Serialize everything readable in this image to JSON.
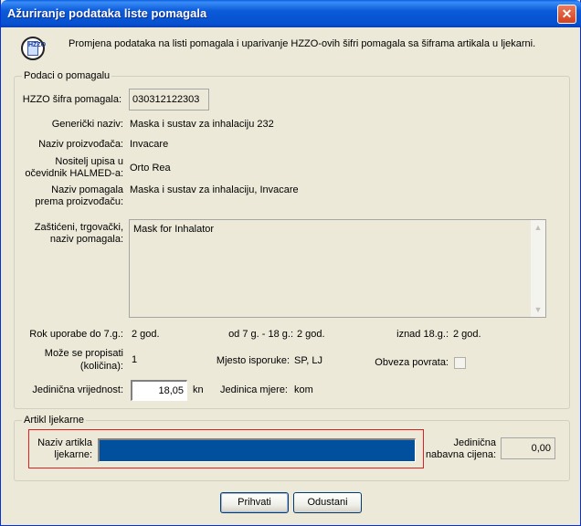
{
  "window": {
    "title": "Ažuriranje podataka liste pomagala",
    "close_glyph": "✕"
  },
  "header": {
    "icon": "hzzo-logo-icon",
    "icon_text": "HZZO",
    "description": "Promjena podataka na listi pomagala i uparivanje HZZO-ovih šifri pomagala sa šiframa artikala u ljekarni."
  },
  "podaci": {
    "legend": "Podaci o pomagalu",
    "sifra_label": "HZZO šifra pomagala:",
    "sifra_value": "030312122303",
    "genericki_label": "Generički naziv:",
    "genericki_value": "Maska i sustav za inhalaciju 232",
    "proizvodjac_label": "Naziv proizvođača:",
    "proizvodjac_value": "Invacare",
    "nositelj_label_1": "Nositelj upisa u",
    "nositelj_label_2": "očevidnik HALMED-a:",
    "nositelj_value": "Orto Rea",
    "naziv_label_1": "Naziv pomagala",
    "naziv_label_2": "prema proizvođaču:",
    "naziv_value": "Maska i sustav za inhalaciju, Invacare",
    "zasticeni_label_1": "Zaštićeni, trgovački,",
    "zasticeni_label_2": "naziv pomagala:",
    "zasticeni_value": "Mask for Inhalator",
    "rok_label": "Rok uporabe do 7.g.:",
    "rok_value": "2 god.",
    "od7_label": "od 7 g. - 18 g.:",
    "od7_value": "2 god.",
    "iznad_label": "iznad 18.g.:",
    "iznad_value": "2 god.",
    "propisati_label_1": "Može se propisati",
    "propisati_label_2": "(količina):",
    "propisati_value": "1",
    "mjesto_label": "Mjesto isporuke:",
    "mjesto_value": "SP, LJ",
    "obveza_label": "Obveza povrata:",
    "obveza_checked": false,
    "jed_vrijednost_label": "Jedinična vrijednost:",
    "jed_vrijednost_value": "18,05",
    "jed_vrijednost_unit": "kn",
    "jed_mjere_label": "Jedinica mjere:",
    "jed_mjere_value": "kom"
  },
  "artikl": {
    "legend": "Artikl ljekarne",
    "naziv_label_1": "Naziv artikla",
    "naziv_label_2": "ljekarne:",
    "naziv_value": "",
    "cijena_label_1": "Jedinična",
    "cijena_label_2": "nabavna cijena:",
    "cijena_value": "0,00"
  },
  "buttons": {
    "prihvati": "Prihvati",
    "odustani": "Odustani"
  },
  "scrollbar": {
    "up_glyph": "▲",
    "down_glyph": "▼"
  },
  "colors": {
    "titlebar": "#0a5fe0",
    "selection": "#00509d",
    "highlight_frame": "#e02020"
  }
}
